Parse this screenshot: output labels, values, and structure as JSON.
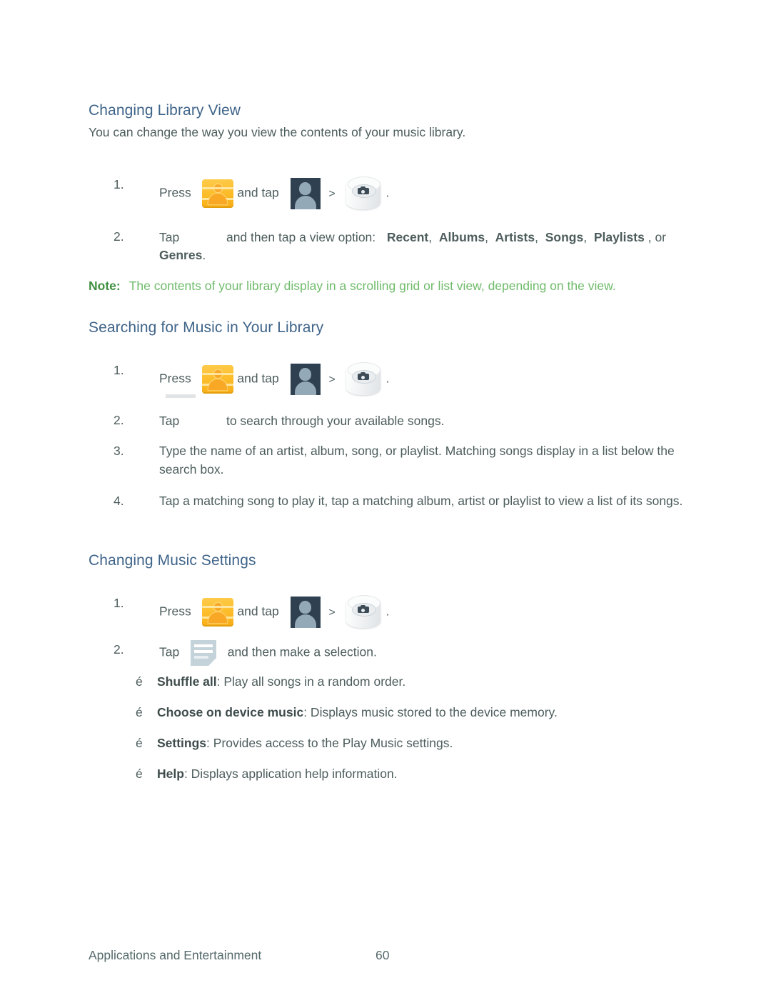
{
  "document": {
    "footer": {
      "section_title": "Applications and Entertainment",
      "page_number": "60"
    }
  },
  "sections": [
    {
      "id": "changing-library-view",
      "heading": "Changing Library View",
      "intro": "You can change the way you view the contents of your music library.",
      "steps": [
        {
          "number": "1.",
          "before_icon": "Press",
          "middle_text": "and tap",
          "after_text": ".",
          "icons": [
            "home-key-icon",
            "person-avatar-icon",
            "play-music-disc-icon"
          ]
        },
        {
          "number": "2.",
          "text_before": "Tap",
          "text_after": "and then tap a view option:",
          "options": [
            "Recent",
            "Albums",
            "Artists",
            "Songs",
            "Playlists"
          ],
          "options_tail": ", or",
          "options_last": "Genres",
          "options_last_tail": "."
        }
      ],
      "note": {
        "label": "Note:",
        "text": "The contents of your library display in a scrolling grid or list view, depending on the view."
      }
    },
    {
      "id": "searching-for-music",
      "heading": "Searching for Music in Your Library",
      "steps": [
        {
          "number": "1.",
          "before_icon": "Press",
          "middle_text": "and tap",
          "after_text": ".",
          "icons": [
            "home-key-icon",
            "person-avatar-icon",
            "play-music-disc-icon"
          ]
        },
        {
          "number": "2.",
          "text_before": "Tap",
          "text_after": "to search through your available songs."
        },
        {
          "number": "3.",
          "text": "Type the name of an artist, album, song, or playlist. Matching songs display in a list below the search box."
        },
        {
          "number": "4.",
          "text": "Tap a matching song to play it, tap a matching album, artist or playlist to view a list of its songs."
        }
      ]
    },
    {
      "id": "changing-music-settings",
      "heading": "Changing Music Settings",
      "steps": [
        {
          "number": "1.",
          "before_icon": "Press",
          "middle_text": "and tap",
          "after_text": ".",
          "icons": [
            "home-key-icon",
            "person-avatar-icon",
            "play-music-disc-icon"
          ]
        },
        {
          "number": "2.",
          "text_before": "Tap",
          "text_after": "and then make a selection.",
          "icons": [
            "menu-list-icon"
          ]
        }
      ],
      "bullets": [
        {
          "marker": "é",
          "term": "Shuffle all",
          "description": ": Play all songs in a random order."
        },
        {
          "marker": "é",
          "term": "Choose on device music",
          "description": ": Displays music stored to the device memory."
        },
        {
          "marker": "é",
          "term": "Settings",
          "description": ": Provides access to the Play Music settings."
        },
        {
          "marker": "é",
          "term": "Help",
          "description": ": Displays application help information."
        }
      ]
    }
  ],
  "colors": {
    "heading": "#3f6489",
    "body_text": "#4d5c5c",
    "note_label": "#3f9040",
    "note_text": "#6fbb6a",
    "home_icon": "#f9bd26",
    "person_icon_bg": "#2f4151",
    "menu_icon": "#c4d2da"
  }
}
